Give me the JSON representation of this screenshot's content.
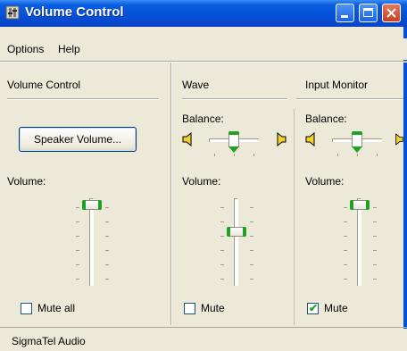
{
  "window": {
    "title": "Volume Control",
    "buttons": {
      "minimize": "minimize-icon",
      "maximize": "maximize-icon",
      "close": "close-icon"
    }
  },
  "menu": [
    "Options",
    "Help"
  ],
  "panels": {
    "master": {
      "title": "Volume Control",
      "button_label": "Speaker Volume...",
      "volume_label": "Volume:",
      "volume_level": 1.0,
      "mute_label": "Mute all",
      "muted": false
    },
    "wave": {
      "title": "Wave",
      "balance_label": "Balance:",
      "balance": 0.5,
      "volume_label": "Volume:",
      "volume_level": 0.62,
      "mute_label": "Mute",
      "muted": false
    },
    "input_monitor": {
      "title": "Input Monitor",
      "balance_label": "Balance:",
      "balance": 0.5,
      "volume_label": "Volume:",
      "volume_level": 1.0,
      "mute_label": "Mute",
      "muted": true,
      "mute_mark": "✔"
    }
  },
  "status": "SigmaTel Audio",
  "colors": {
    "titlebar": "#0450d8",
    "slider_accent": "#21a121",
    "close": "#c6401f"
  }
}
